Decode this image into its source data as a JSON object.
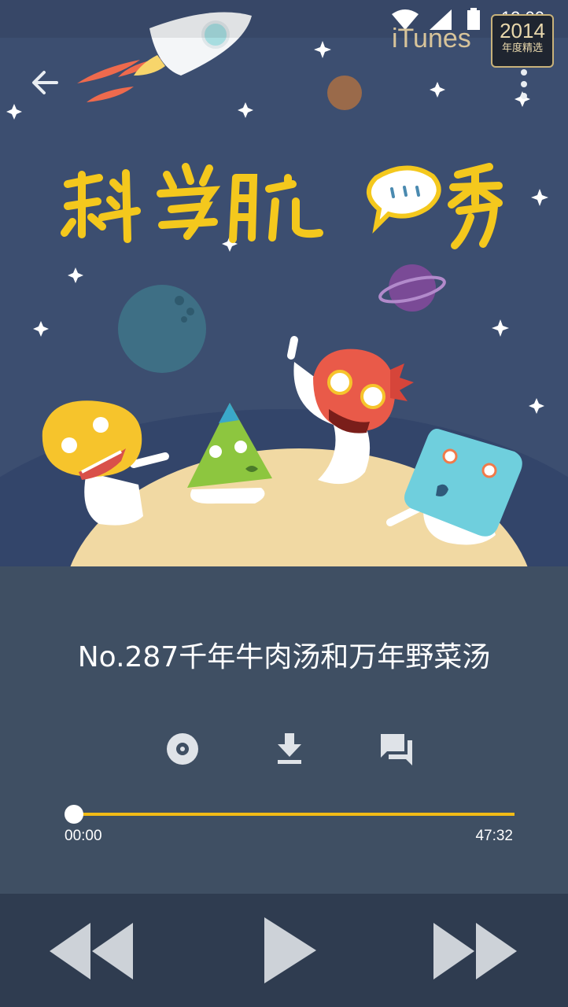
{
  "status_bar": {
    "time": "12:00"
  },
  "badge": {
    "itunes": "iTunes",
    "year": "2014",
    "subtitle": "年度精选"
  },
  "cover": {
    "show_title": "科学脱口秀"
  },
  "episode": {
    "title": "No.287千年牛肉汤和万年野菜汤"
  },
  "progress": {
    "elapsed": "00:00",
    "duration": "47:32",
    "fraction": 0.0
  },
  "icons": {
    "back": "arrow-back-icon",
    "more": "more-vert-icon",
    "disc": "disc-icon",
    "download": "download-icon",
    "comments": "comments-icon",
    "rewind": "rewind-icon",
    "play": "play-icon",
    "fast_forward": "fast-forward-icon"
  },
  "colors": {
    "accent": "#f2bb16",
    "cover_bg": "#3c4e70",
    "panel_bg": "#3f4f63",
    "controls_bg": "#2f3c50"
  }
}
